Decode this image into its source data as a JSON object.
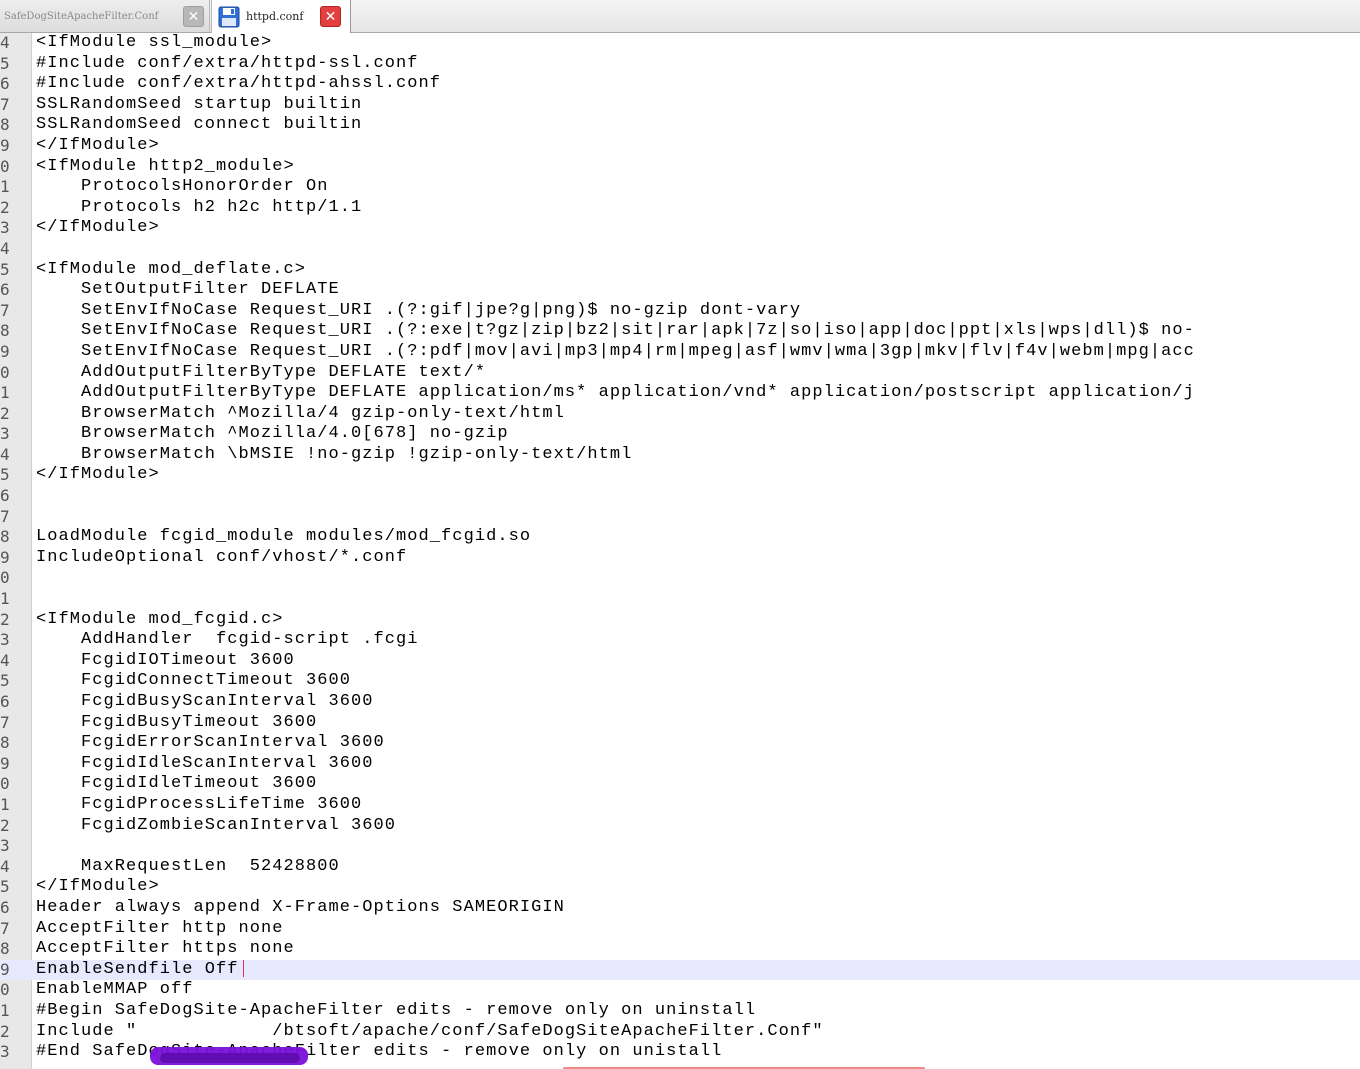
{
  "tabs": [
    {
      "label": "SafeDogSiteApacheFilter.Conf",
      "active": false
    },
    {
      "label": "httpd.conf",
      "active": true
    }
  ],
  "editor": {
    "current_line_index": 45,
    "lines": [
      {
        "num": "4",
        "text": "<IfModule ssl_module>"
      },
      {
        "num": "5",
        "text": "#Include conf/extra/httpd-ssl.conf"
      },
      {
        "num": "6",
        "text": "#Include conf/extra/httpd-ahssl.conf"
      },
      {
        "num": "7",
        "text": "SSLRandomSeed startup builtin"
      },
      {
        "num": "8",
        "text": "SSLRandomSeed connect builtin"
      },
      {
        "num": "9",
        "text": "</IfModule>"
      },
      {
        "num": "0",
        "text": "<IfModule http2_module>"
      },
      {
        "num": "1",
        "text": "    ProtocolsHonorOrder On"
      },
      {
        "num": "2",
        "text": "    Protocols h2 h2c http/1.1"
      },
      {
        "num": "3",
        "text": "</IfModule>"
      },
      {
        "num": "4",
        "text": ""
      },
      {
        "num": "5",
        "text": "<IfModule mod_deflate.c>"
      },
      {
        "num": "6",
        "text": "    SetOutputFilter DEFLATE"
      },
      {
        "num": "7",
        "text": "    SetEnvIfNoCase Request_URI .(?:gif|jpe?g|png)$ no-gzip dont-vary"
      },
      {
        "num": "8",
        "text": "    SetEnvIfNoCase Request_URI .(?:exe|t?gz|zip|bz2|sit|rar|apk|7z|so|iso|app|doc|ppt|xls|wps|dll)$ no-"
      },
      {
        "num": "9",
        "text": "    SetEnvIfNoCase Request_URI .(?:pdf|mov|avi|mp3|mp4|rm|mpeg|asf|wmv|wma|3gp|mkv|flv|f4v|webm|mpg|acc"
      },
      {
        "num": "0",
        "text": "    AddOutputFilterByType DEFLATE text/*"
      },
      {
        "num": "1",
        "text": "    AddOutputFilterByType DEFLATE application/ms* application/vnd* application/postscript application/j"
      },
      {
        "num": "2",
        "text": "    BrowserMatch ^Mozilla/4 gzip-only-text/html"
      },
      {
        "num": "3",
        "text": "    BrowserMatch ^Mozilla/4.0[678] no-gzip"
      },
      {
        "num": "4",
        "text": "    BrowserMatch \\bMSIE !no-gzip !gzip-only-text/html"
      },
      {
        "num": "5",
        "text": "</IfModule>"
      },
      {
        "num": "6",
        "text": ""
      },
      {
        "num": "7",
        "text": ""
      },
      {
        "num": "8",
        "text": "LoadModule fcgid_module modules/mod_fcgid.so"
      },
      {
        "num": "9",
        "text": "IncludeOptional conf/vhost/*.conf"
      },
      {
        "num": "0",
        "text": ""
      },
      {
        "num": "1",
        "text": ""
      },
      {
        "num": "2",
        "text": "<IfModule mod_fcgid.c>"
      },
      {
        "num": "3",
        "text": "    AddHandler  fcgid-script .fcgi"
      },
      {
        "num": "4",
        "text": "    FcgidIOTimeout 3600"
      },
      {
        "num": "5",
        "text": "    FcgidConnectTimeout 3600"
      },
      {
        "num": "6",
        "text": "    FcgidBusyScanInterval 3600"
      },
      {
        "num": "7",
        "text": "    FcgidBusyTimeout 3600"
      },
      {
        "num": "8",
        "text": "    FcgidErrorScanInterval 3600"
      },
      {
        "num": "9",
        "text": "    FcgidIdleScanInterval 3600"
      },
      {
        "num": "0",
        "text": "    FcgidIdleTimeout 3600"
      },
      {
        "num": "1",
        "text": "    FcgidProcessLifeTime 3600"
      },
      {
        "num": "2",
        "text": "    FcgidZombieScanInterval 3600"
      },
      {
        "num": "3",
        "text": ""
      },
      {
        "num": "4",
        "text": "    MaxRequestLen  52428800"
      },
      {
        "num": "5",
        "text": "</IfModule>"
      },
      {
        "num": "6",
        "text": "Header always append X-Frame-Options SAMEORIGIN"
      },
      {
        "num": "7",
        "text": "AcceptFilter http none"
      },
      {
        "num": "8",
        "text": "AcceptFilter https none"
      },
      {
        "num": "9",
        "text": "EnableSendfile Off"
      },
      {
        "num": "0",
        "text": "EnableMMAP off"
      },
      {
        "num": "1",
        "text": "#Begin SafeDogSite-ApacheFilter edits - remove only on uninstall"
      },
      {
        "num": "2",
        "text": "Include \"            /btsoft/apache/conf/SafeDogSiteApacheFilter.Conf\""
      },
      {
        "num": "3",
        "text": "#End SafeDogSite-ApacheFilter edits - remove only on unistall"
      }
    ]
  }
}
